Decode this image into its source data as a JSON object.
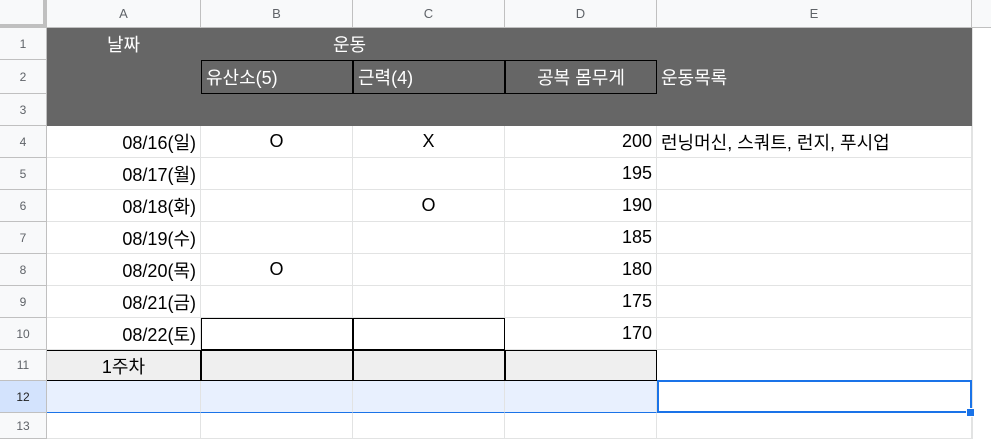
{
  "columns": [
    "A",
    "B",
    "C",
    "D",
    "E"
  ],
  "rows": [
    "1",
    "2",
    "3",
    "4",
    "5",
    "6",
    "7",
    "8",
    "9",
    "10",
    "11",
    "12",
    "13"
  ],
  "header": {
    "r1_a": "날짜",
    "r1_c": "운동",
    "r2_b": "유산소(5)",
    "r2_c": "근력(4)",
    "r2_d": "공복 몸무게",
    "r2_e": "운동목록"
  },
  "data_rows": [
    {
      "date": "08/16(일)",
      "cardio": "O",
      "strength": "X",
      "weight": "200",
      "list": "런닝머신, 스쿼트, 런지, 푸시업"
    },
    {
      "date": "08/17(월)",
      "cardio": "",
      "strength": "",
      "weight": "195",
      "list": ""
    },
    {
      "date": "08/18(화)",
      "cardio": "",
      "strength": "O",
      "weight": "190",
      "list": ""
    },
    {
      "date": "08/19(수)",
      "cardio": "",
      "strength": "",
      "weight": "185",
      "list": ""
    },
    {
      "date": "08/20(목)",
      "cardio": "O",
      "strength": "",
      "weight": "180",
      "list": ""
    },
    {
      "date": "08/21(금)",
      "cardio": "",
      "strength": "",
      "weight": "175",
      "list": ""
    },
    {
      "date": "08/22(토)",
      "cardio": "",
      "strength": "",
      "weight": "170",
      "list": ""
    }
  ],
  "week_label": "1주차",
  "colors": {
    "header_dark": "#666666",
    "selection": "#1a73e8",
    "row_highlight": "#e8f0fe",
    "summary_gray": "#efefef"
  }
}
